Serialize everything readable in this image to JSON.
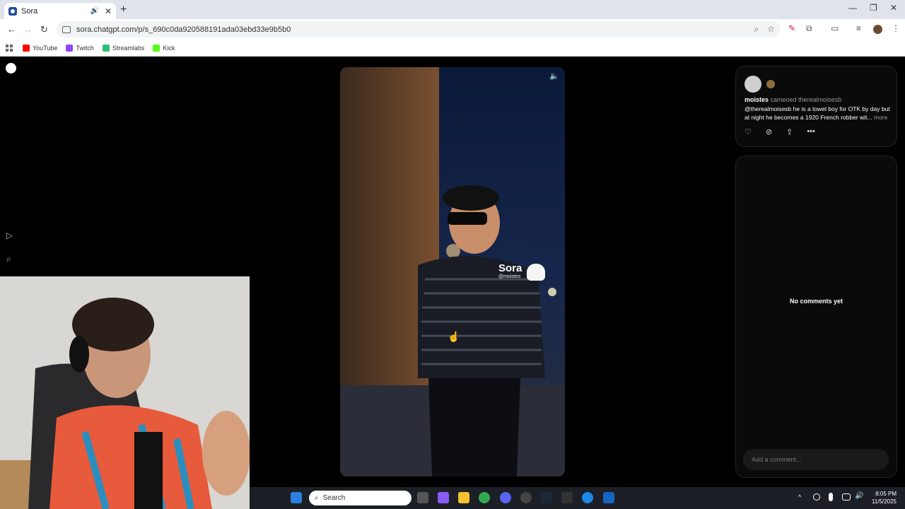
{
  "browser": {
    "tab_title": "Sora",
    "url": "sora.chatgpt.com/p/s_690c0da920588191ada03ebd33e9b5b0",
    "bookmarks": [
      {
        "label": "YouTube",
        "color": "#ff0000"
      },
      {
        "label": "Twitch",
        "color": "#9146ff"
      },
      {
        "label": "Streamlabs",
        "color": "#2fbf71"
      },
      {
        "label": "Kick",
        "color": "#53fc18"
      }
    ]
  },
  "post": {
    "author": "moistes",
    "cameo_text": "cameoed therealmoisesb",
    "description": "@therealmoisesb he is a towel boy for OTK by day but at night he becomes a 1920 French robber wit...",
    "more_label": "more",
    "watermark_title": "Sora",
    "watermark_handle": "@moistes"
  },
  "comments": {
    "empty_text": "No comments yet",
    "placeholder": "Add a comment..."
  },
  "taskbar": {
    "search_label": "Search",
    "time": "8:05 PM",
    "date": "11/5/2025"
  }
}
